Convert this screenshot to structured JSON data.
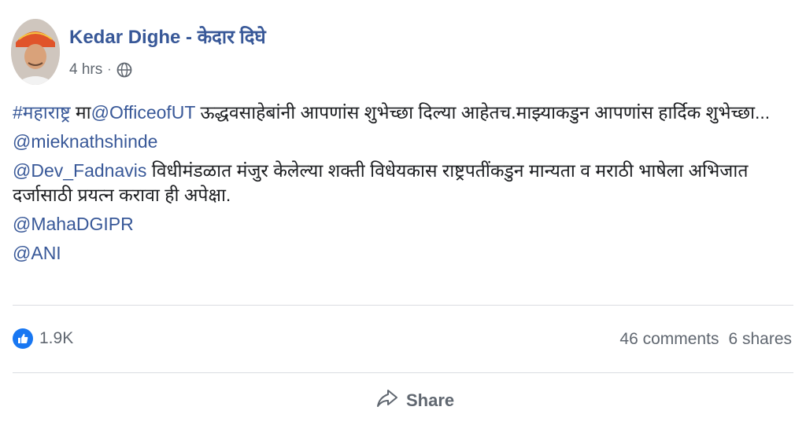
{
  "post": {
    "author": "Kedar Dighe - केदार दिघे",
    "time": "4 hrs",
    "separator": "·",
    "privacy_icon": "globe-icon",
    "body": {
      "line1_hashtag": "#महाराष्ट्र",
      "line1_prefix": " मा",
      "line1_mention": "@OfficeofUT",
      "line1_rest": " ऊद्धवसाहेबांनी आपणांस शुभेच्छा दिल्या आहेतच.माझ्याकडुन आपणांस हार्दिक शुभेच्छा...",
      "mention2": "@mieknathshinde",
      "mention3": "@Dev_Fadnavis",
      "line3_rest": " विधीमंडळात मंजुर केलेल्या शक्ती विधेयकास राष्ट्रपतींकडुन मान्यता व मराठी भाषेला अभिजात दर्जासाठी प्रयत्न करावा ही अपेक्षा.",
      "mention4": "@MahaDGIPR",
      "mention5": "@ANI"
    }
  },
  "stats": {
    "reactions": "1.9K",
    "comments": "46 comments",
    "shares": "6 shares"
  },
  "actions": {
    "share_label": "Share"
  },
  "colors": {
    "link": "#385898",
    "text": "#1c1e21",
    "muted": "#606770",
    "like": "#1877f2"
  }
}
